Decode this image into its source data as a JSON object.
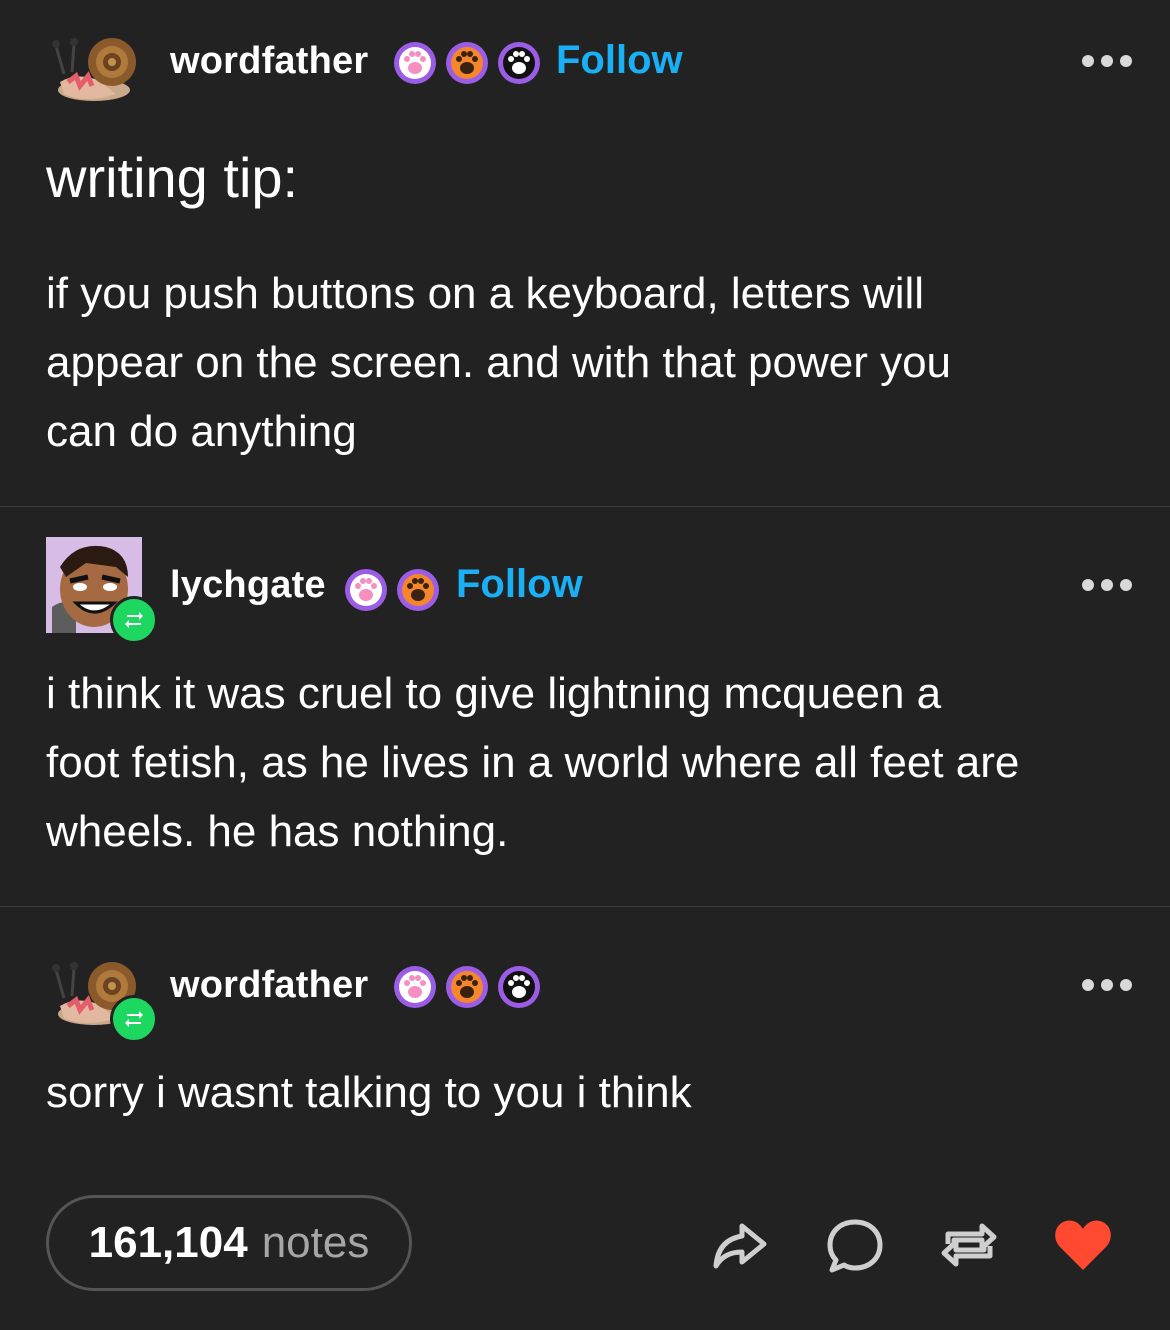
{
  "posts": [
    {
      "username": "wordfather",
      "follow_label": "Follow",
      "title": "writing tip:",
      "body": "if you push buttons on a keyboard, letters will\nappear on the screen. and with that power you\ncan do anything"
    },
    {
      "username": "lychgate",
      "follow_label": "Follow",
      "body": " i think it was cruel to give lightning mcqueen a\nfoot fetish, as he lives in a world where all feet are\nwheels. he has nothing."
    },
    {
      "username": "wordfather",
      "body": "sorry i wasnt talking to you i think"
    }
  ],
  "footer": {
    "notes_count": "161,104",
    "notes_label": "notes"
  },
  "colors": {
    "background": "#222222",
    "follow": "#1ab0f5",
    "reblog_badge": "#1ed760",
    "like": "#ff4930"
  },
  "icons": [
    "snail-avatar",
    "cartoon-avatar",
    "paw-badge-pink",
    "paw-badge-orange",
    "paw-badge-black",
    "more-icon",
    "reblog-icon",
    "share-icon",
    "reply-icon",
    "like-icon"
  ]
}
